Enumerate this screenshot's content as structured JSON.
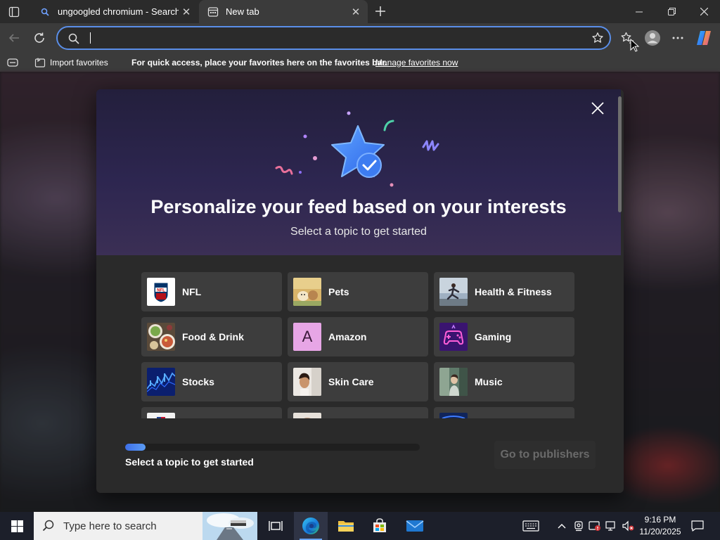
{
  "browser": {
    "tabs": [
      {
        "title": "ungoogled chromium - Search",
        "active": false,
        "icon": "search-icon"
      },
      {
        "title": "New tab",
        "active": true,
        "icon": "newtab-icon"
      }
    ],
    "address": {
      "value": "",
      "placeholder": ""
    },
    "favorites_bar": {
      "import_label": "Import favorites",
      "hint": "For quick access, place your favorites here on the favorites bar.",
      "manage_link": "Manage favorites now"
    },
    "accent": "#5a8ee8"
  },
  "modal": {
    "title": "Personalize your feed based on your interests",
    "subtitle": "Select a topic to get started",
    "topics": [
      {
        "label": "NFL",
        "thumb": "nfl"
      },
      {
        "label": "Pets",
        "thumb": "pets"
      },
      {
        "label": "Health & Fitness",
        "thumb": "fitness"
      },
      {
        "label": "Food & Drink",
        "thumb": "food"
      },
      {
        "label": "Amazon",
        "thumb": "amazon",
        "letter": "A"
      },
      {
        "label": "Gaming",
        "thumb": "gaming"
      },
      {
        "label": "Stocks",
        "thumb": "stocks"
      },
      {
        "label": "Skin Care",
        "thumb": "skincare"
      },
      {
        "label": "Music",
        "thumb": "music"
      }
    ],
    "progress_text": "Select a topic to get started",
    "progress": 0.07,
    "go_button": "Go to publishers"
  },
  "taskbar": {
    "search_placeholder": "Type here to search",
    "time": "9:16 PM",
    "date": "11/20/2025"
  }
}
